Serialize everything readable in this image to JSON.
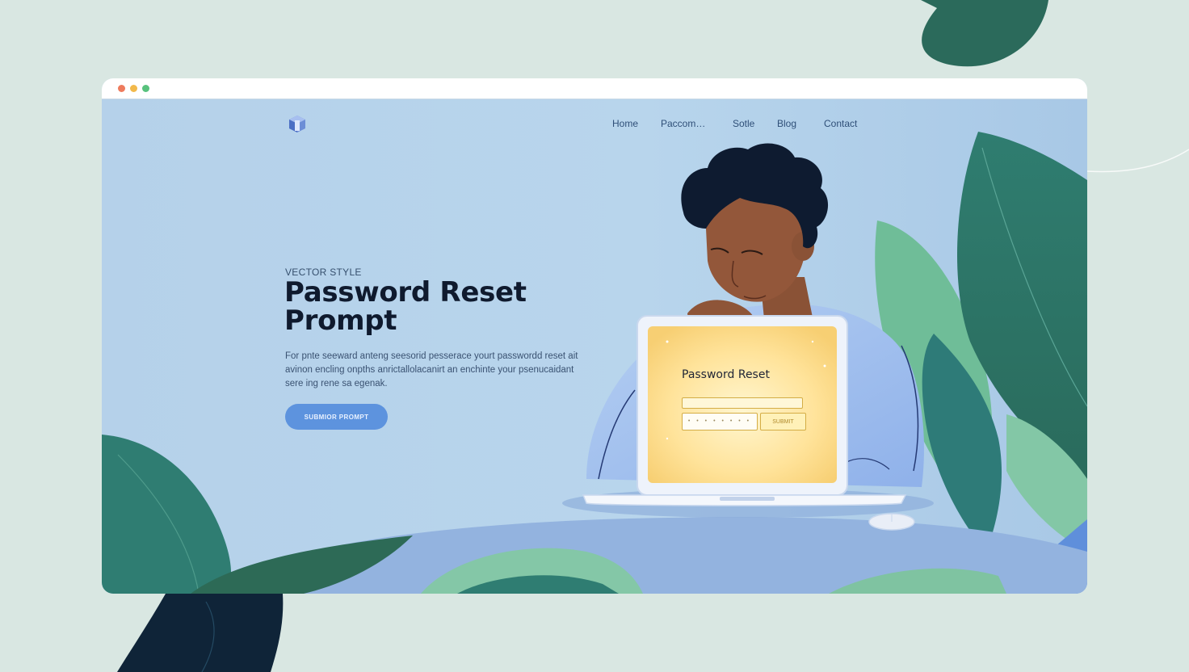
{
  "window": {
    "traffic_lights": [
      "#ee7b5d",
      "#f2b94b",
      "#58c27d"
    ]
  },
  "nav": {
    "items": [
      {
        "label": "Home"
      },
      {
        "label": "Paccom…"
      },
      {
        "label": "Sotle"
      },
      {
        "label": "Blog"
      },
      {
        "label": "Contact"
      }
    ]
  },
  "hero": {
    "eyebrow": "VECTOR STYLE",
    "title": "Password Reset Prompt",
    "description": "For pnte seeward anteng seesorid pesserace yourt passwordd reset ait avinon encling onpths anrictallolacanirt an enchinte your psenucaidant sere ing rene sa egenak.",
    "cta_label": "SUBMIOR PROMPT"
  },
  "form": {
    "title": "Password Reset",
    "password_placeholder": "• • • • • • • • • •",
    "submit_label": "SUBMIT"
  },
  "colors": {
    "page_bg": "#d9e7e2",
    "viewport_bg": "#b7d3ea",
    "accent": "#5d93de",
    "leaf_dark": "#2a6b5c",
    "leaf_light": "#7fc3a1",
    "screen_glow": "#ffe08a"
  },
  "icons": {
    "logo": "cube-logo-icon"
  }
}
